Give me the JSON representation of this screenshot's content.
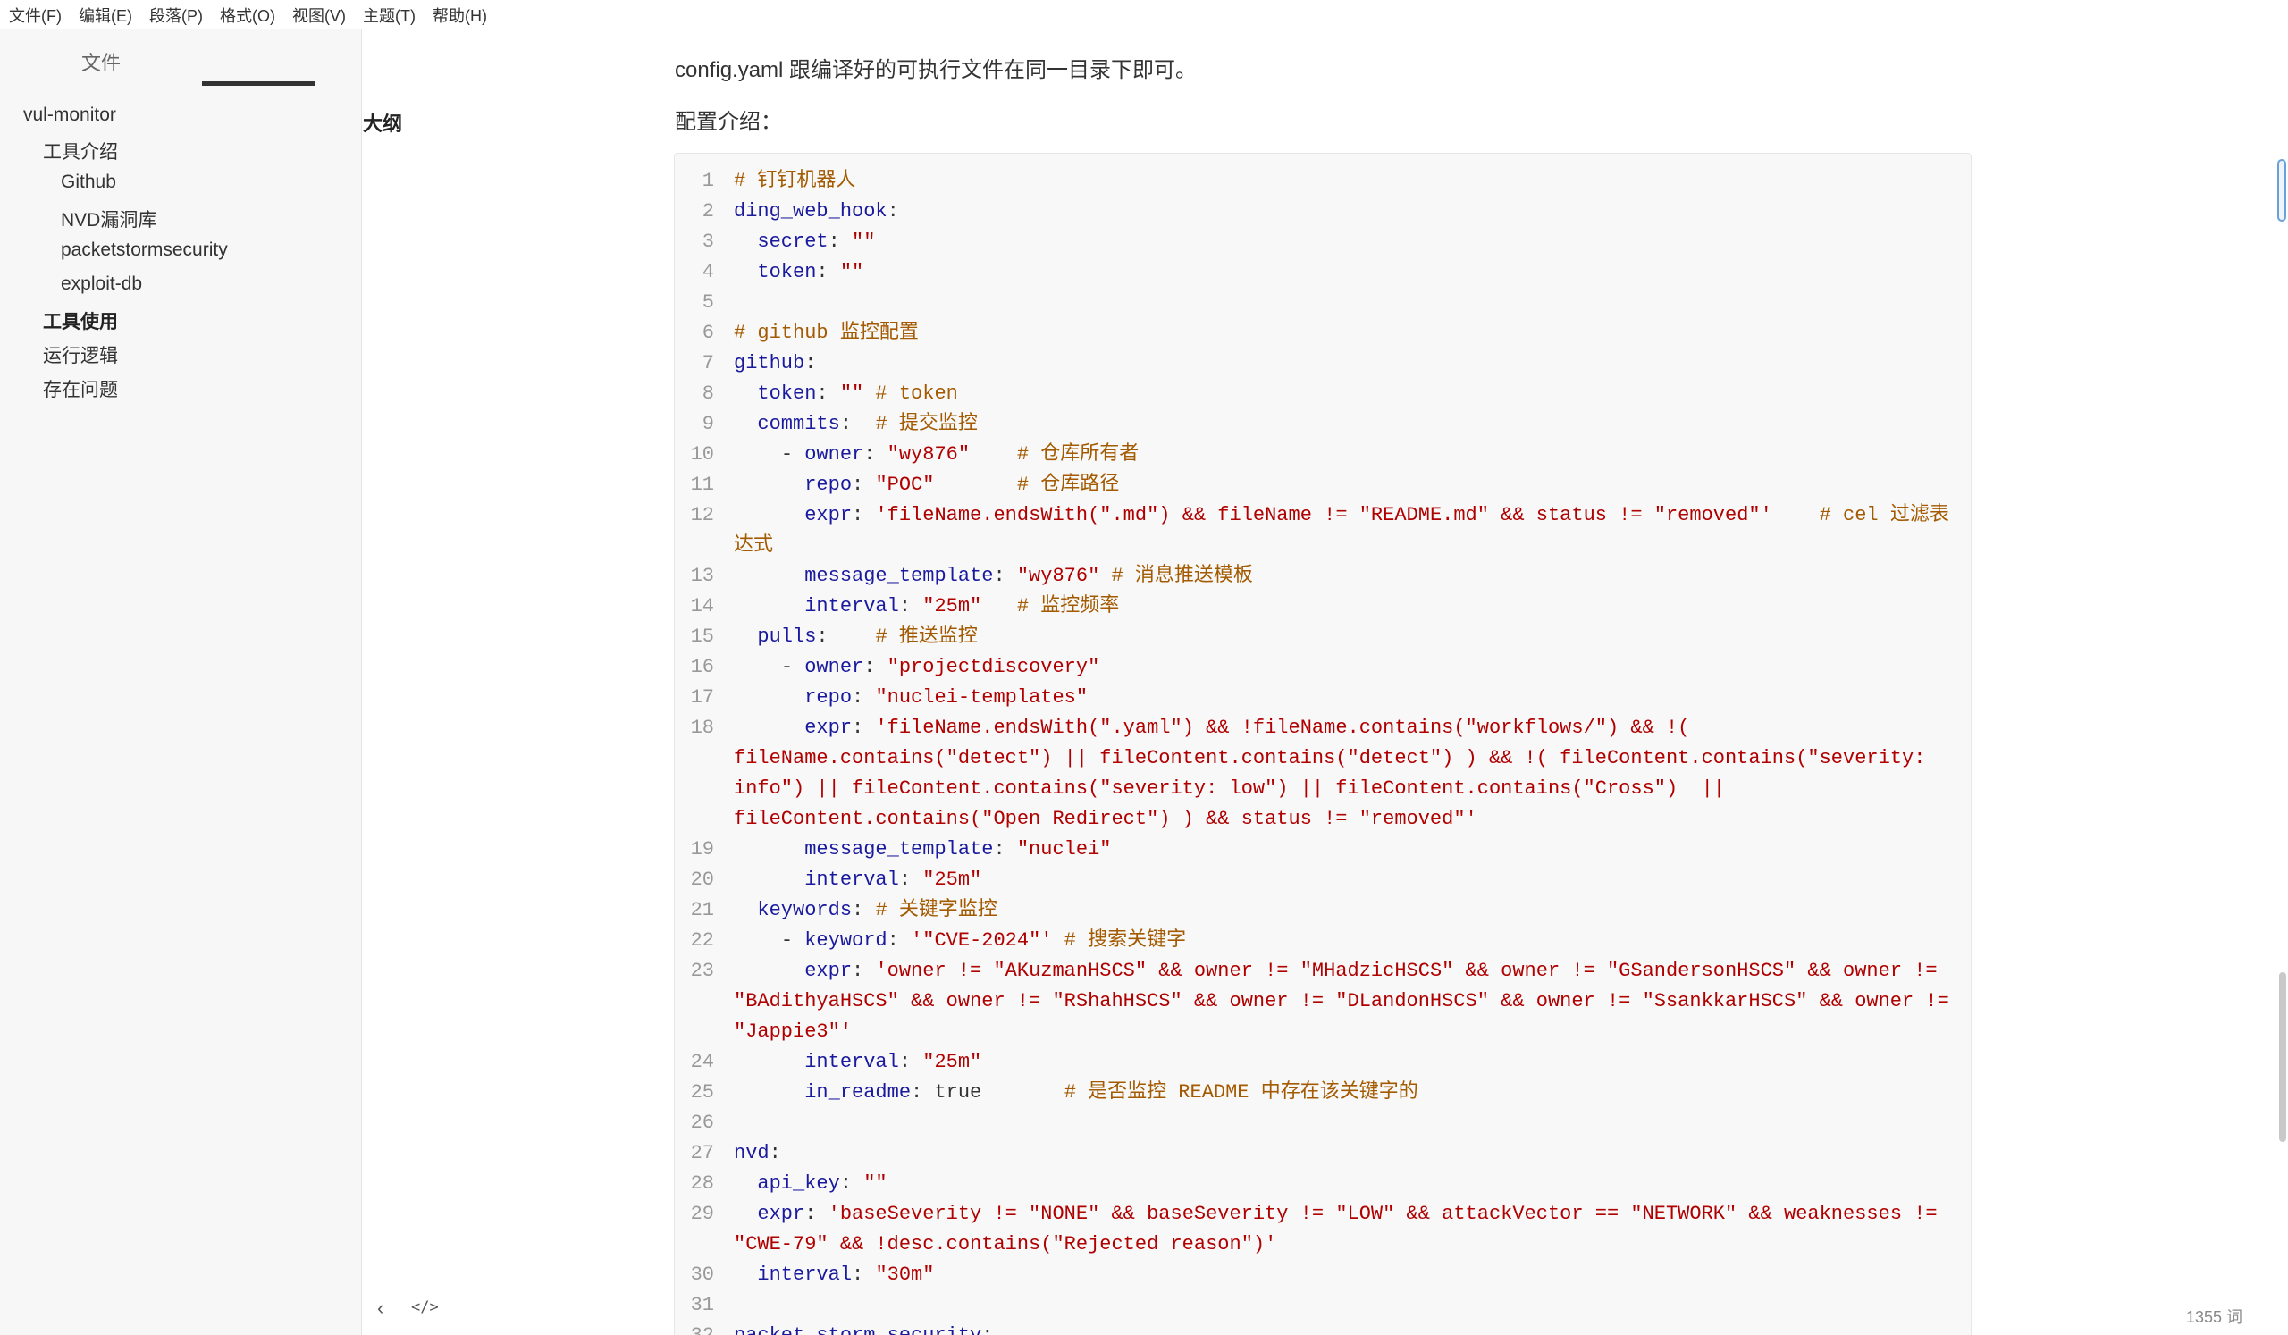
{
  "menubar": {
    "items": [
      "文件(F)",
      "编辑(E)",
      "段落(P)",
      "格式(O)",
      "视图(V)",
      "主题(T)",
      "帮助(H)"
    ]
  },
  "sidebar": {
    "tabs": {
      "files": "文件",
      "outline": "大纲"
    },
    "outline": [
      "vul-monitor",
      "工具介绍",
      "Github",
      "NVD漏洞库",
      "packetstormsecurity",
      "exploit-db",
      "工具使用",
      "运行逻辑",
      "存在问题"
    ],
    "active_item": "工具使用"
  },
  "content": {
    "para1": "config.yaml 跟编译好的可执行文件在同一目录下即可。",
    "para2": "配置介绍：",
    "code_lines": [
      {
        "n": "1",
        "segs": [
          [
            "c",
            "# 钉钉机器人"
          ]
        ]
      },
      {
        "n": "2",
        "segs": [
          [
            "k",
            "ding_web_hook"
          ],
          [
            "p",
            ":"
          ]
        ]
      },
      {
        "n": "3",
        "segs": [
          [
            "k",
            "  secret"
          ],
          [
            "p",
            ": "
          ],
          [
            "s",
            "\"\""
          ]
        ]
      },
      {
        "n": "4",
        "segs": [
          [
            "k",
            "  token"
          ],
          [
            "p",
            ": "
          ],
          [
            "s",
            "\"\""
          ]
        ]
      },
      {
        "n": "5",
        "segs": [
          [
            "p",
            ""
          ]
        ]
      },
      {
        "n": "6",
        "segs": [
          [
            "c",
            "# github 监控配置"
          ]
        ]
      },
      {
        "n": "7",
        "segs": [
          [
            "k",
            "github"
          ],
          [
            "p",
            ":"
          ]
        ]
      },
      {
        "n": "8",
        "segs": [
          [
            "k",
            "  token"
          ],
          [
            "p",
            ": "
          ],
          [
            "s",
            "\"\""
          ],
          [
            "c",
            " # token"
          ]
        ]
      },
      {
        "n": "9",
        "segs": [
          [
            "k",
            "  commits"
          ],
          [
            "p",
            ":  "
          ],
          [
            "c",
            "# 提交监控"
          ]
        ]
      },
      {
        "n": "10",
        "segs": [
          [
            "p",
            "    - "
          ],
          [
            "k",
            "owner"
          ],
          [
            "p",
            ": "
          ],
          [
            "s",
            "\"wy876\""
          ],
          [
            "c",
            "    # 仓库所有者"
          ]
        ]
      },
      {
        "n": "11",
        "segs": [
          [
            "k",
            "      repo"
          ],
          [
            "p",
            ": "
          ],
          [
            "s",
            "\"POC\""
          ],
          [
            "c",
            "       # 仓库路径"
          ]
        ]
      },
      {
        "n": "12",
        "segs": [
          [
            "k",
            "      expr"
          ],
          [
            "p",
            ": "
          ],
          [
            "s",
            "'fileName.endsWith(\".md\") && fileName != \"README.md\" && status != \"removed\"'"
          ],
          [
            "c",
            "    # cel 过滤表达式"
          ]
        ]
      },
      {
        "n": "13",
        "segs": [
          [
            "k",
            "      message_template"
          ],
          [
            "p",
            ": "
          ],
          [
            "s",
            "\"wy876\""
          ],
          [
            "c",
            " # 消息推送模板"
          ]
        ]
      },
      {
        "n": "14",
        "segs": [
          [
            "k",
            "      interval"
          ],
          [
            "p",
            ": "
          ],
          [
            "s",
            "\"25m\""
          ],
          [
            "c",
            "   # 监控频率"
          ]
        ]
      },
      {
        "n": "15",
        "segs": [
          [
            "k",
            "  pulls"
          ],
          [
            "p",
            ":    "
          ],
          [
            "c",
            "# 推送监控"
          ]
        ]
      },
      {
        "n": "16",
        "segs": [
          [
            "p",
            "    - "
          ],
          [
            "k",
            "owner"
          ],
          [
            "p",
            ": "
          ],
          [
            "s",
            "\"projectdiscovery\""
          ]
        ]
      },
      {
        "n": "17",
        "segs": [
          [
            "k",
            "      repo"
          ],
          [
            "p",
            ": "
          ],
          [
            "s",
            "\"nuclei-templates\""
          ]
        ]
      },
      {
        "n": "18",
        "segs": [
          [
            "k",
            "      expr"
          ],
          [
            "p",
            ": "
          ],
          [
            "s",
            "'fileName.endsWith(\".yaml\") && !fileName.contains(\"workflows/\") && !( fileName.contains(\"detect\") || fileContent.contains(\"detect\") ) && !( fileContent.contains(\"severity: info\") || fileContent.contains(\"severity: low\") || fileContent.contains(\"Cross\")  || fileContent.contains(\"Open Redirect\") ) && status != \"removed\"'"
          ]
        ]
      },
      {
        "n": "19",
        "segs": [
          [
            "k",
            "      message_template"
          ],
          [
            "p",
            ": "
          ],
          [
            "s",
            "\"nuclei\""
          ]
        ]
      },
      {
        "n": "20",
        "segs": [
          [
            "k",
            "      interval"
          ],
          [
            "p",
            ": "
          ],
          [
            "s",
            "\"25m\""
          ]
        ]
      },
      {
        "n": "21",
        "segs": [
          [
            "k",
            "  keywords"
          ],
          [
            "p",
            ": "
          ],
          [
            "c",
            "# 关键字监控"
          ]
        ]
      },
      {
        "n": "22",
        "segs": [
          [
            "p",
            "    - "
          ],
          [
            "k",
            "keyword"
          ],
          [
            "p",
            ": "
          ],
          [
            "s",
            "'\"CVE-2024\"'"
          ],
          [
            "c",
            " # 搜索关键字"
          ]
        ]
      },
      {
        "n": "23",
        "segs": [
          [
            "k",
            "      expr"
          ],
          [
            "p",
            ": "
          ],
          [
            "s",
            "'owner != \"AKuzmanHSCS\" && owner != \"MHadzicHSCS\" && owner != \"GSandersonHSCS\" && owner != \"BAdithyaHSCS\" && owner != \"RShahHSCS\" && owner != \"DLandonHSCS\" && owner != \"SsankkarHSCS\" && owner != \"Jappie3\"'"
          ]
        ]
      },
      {
        "n": "24",
        "segs": [
          [
            "k",
            "      interval"
          ],
          [
            "p",
            ": "
          ],
          [
            "s",
            "\"25m\""
          ]
        ]
      },
      {
        "n": "25",
        "segs": [
          [
            "k",
            "      in_readme"
          ],
          [
            "p",
            ": true       "
          ],
          [
            "c",
            "# 是否监控 README 中存在该关键字的"
          ]
        ]
      },
      {
        "n": "26",
        "segs": [
          [
            "p",
            ""
          ]
        ]
      },
      {
        "n": "27",
        "segs": [
          [
            "k",
            "nvd"
          ],
          [
            "p",
            ":"
          ]
        ]
      },
      {
        "n": "28",
        "segs": [
          [
            "k",
            "  api_key"
          ],
          [
            "p",
            ": "
          ],
          [
            "s",
            "\"\""
          ]
        ]
      },
      {
        "n": "29",
        "segs": [
          [
            "k",
            "  expr"
          ],
          [
            "p",
            ": "
          ],
          [
            "s",
            "'baseSeverity != \"NONE\" && baseSeverity != \"LOW\" && attackVector == \"NETWORK\" && weaknesses != \"CWE-79\" && !desc.contains(\"Rejected reason\")'"
          ]
        ]
      },
      {
        "n": "30",
        "segs": [
          [
            "k",
            "  interval"
          ],
          [
            "p",
            ": "
          ],
          [
            "s",
            "\"30m\""
          ]
        ]
      },
      {
        "n": "31",
        "segs": [
          [
            "p",
            ""
          ]
        ]
      },
      {
        "n": "32",
        "segs": [
          [
            "k",
            "packet_storm_security"
          ],
          [
            "p",
            ":"
          ]
        ]
      }
    ]
  },
  "footer": {
    "back_icon": "‹",
    "source_icon": "</>",
    "word_count": "1355 词"
  }
}
